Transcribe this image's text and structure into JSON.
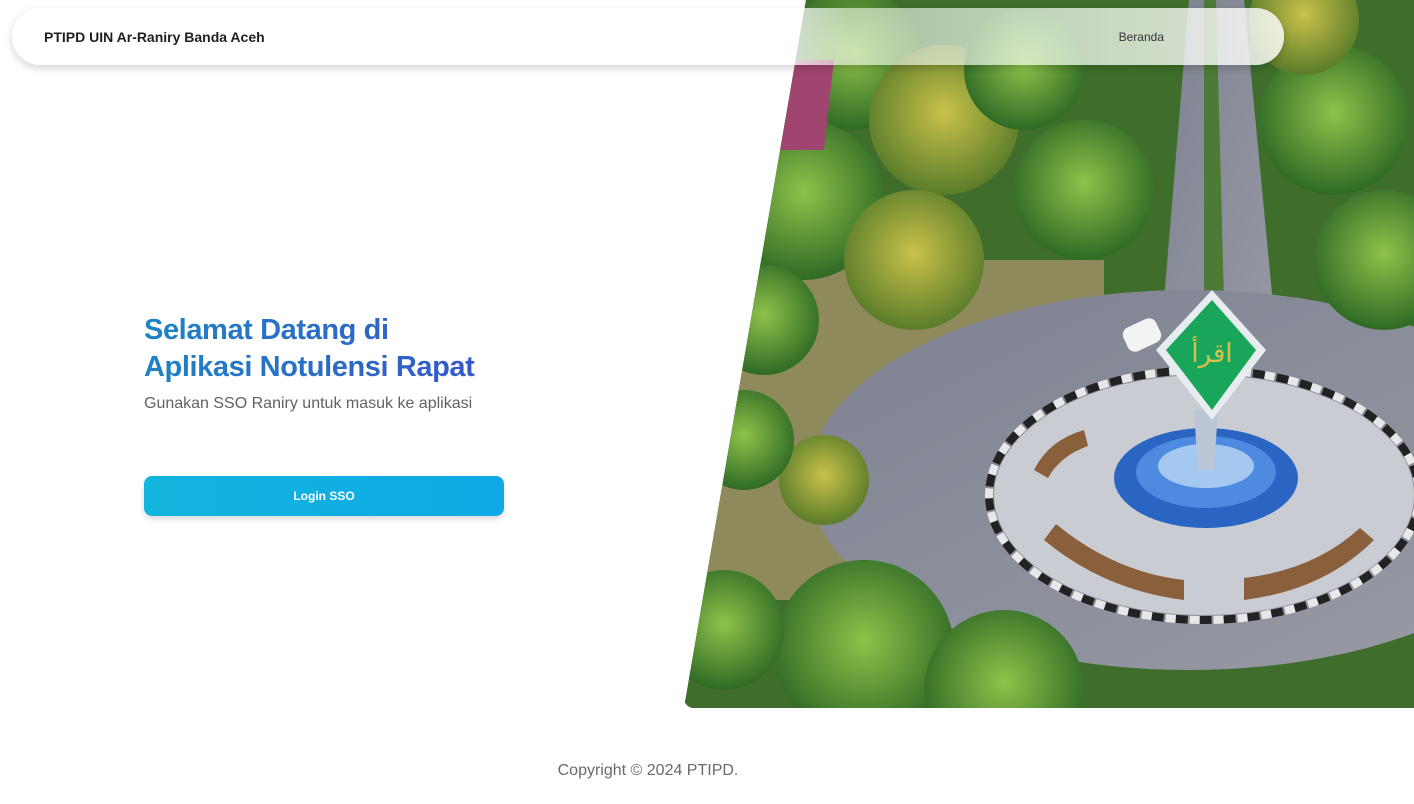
{
  "navbar": {
    "brand": "PTIPD UIN Ar-Raniry Banda Aceh",
    "links": [
      {
        "label": "Beranda"
      }
    ]
  },
  "hero": {
    "title_line1": "Selamat Datang di",
    "title_line2": "Aplikasi Notulensi Rapat",
    "subtitle": "Gunakan SSO Raniry untuk masuk ke aplikasi",
    "login_button": "Login SSO",
    "monument_text": "اقرأ"
  },
  "footer": {
    "copyright": "Copyright © 2024 PTIPD."
  },
  "colors": {
    "accent": "#12b5de",
    "title_start": "#1d84c4",
    "title_end": "#3559c9"
  }
}
